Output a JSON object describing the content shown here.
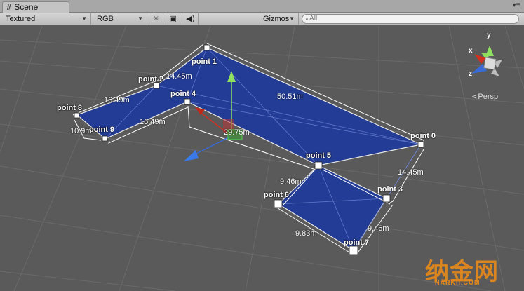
{
  "window": {
    "tab_title": "Scene",
    "tab_icon": "grid-icon",
    "menu_icon": "tab-menu-icon"
  },
  "toolbar": {
    "draw_mode": "Textured",
    "render_mode": "RGB",
    "lighting_icon": "sun-icon",
    "image_icon": "image-icon",
    "audio_icon": "speaker-icon",
    "gizmos_label": "Gizmos",
    "search_placeholder": "All"
  },
  "scene": {
    "points": [
      {
        "label": "point 0"
      },
      {
        "label": "point 1"
      },
      {
        "label": "point 2"
      },
      {
        "label": "point 3"
      },
      {
        "label": "point 4"
      },
      {
        "label": "point 5"
      },
      {
        "label": "point 6"
      },
      {
        "label": "point 7"
      },
      {
        "label": "point 8"
      },
      {
        "label": "point 9"
      }
    ],
    "distances": [
      "14.45m",
      "50.51m",
      "16.49m",
      "16.49m",
      "10.9m",
      "29.75m",
      "14.45m",
      "9.46m",
      "9.46m",
      "9.83m"
    ],
    "mesh_color": "#1e3a9a",
    "background_color": "#5a5a5a"
  },
  "gizmo": {
    "y": "y",
    "x": "x",
    "z": "z",
    "projection": "Persp"
  },
  "watermark": {
    "main": "纳金网",
    "sub": "NARKII.COM"
  }
}
